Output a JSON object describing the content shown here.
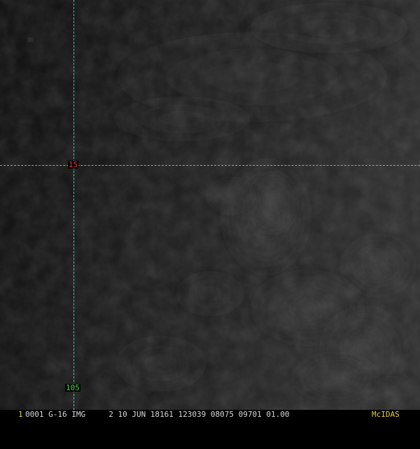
{
  "grid": {
    "latitude_label": "15",
    "longitude_label": "105",
    "line_color": "#39c9cf",
    "latitude_label_color": "#e0403a",
    "longitude_label_color": "#3ee03e"
  },
  "status_bar": {
    "frame_number": "1",
    "text": "0001 G-16 IMG     2 10 JUN 18161 123039 08075 09701 01.00",
    "brand": "McIDAS",
    "text_color": "#d8d8d8",
    "highlight_color": "#e8d03a"
  },
  "image": {
    "description_icon": "satellite-cloud-imagery"
  }
}
